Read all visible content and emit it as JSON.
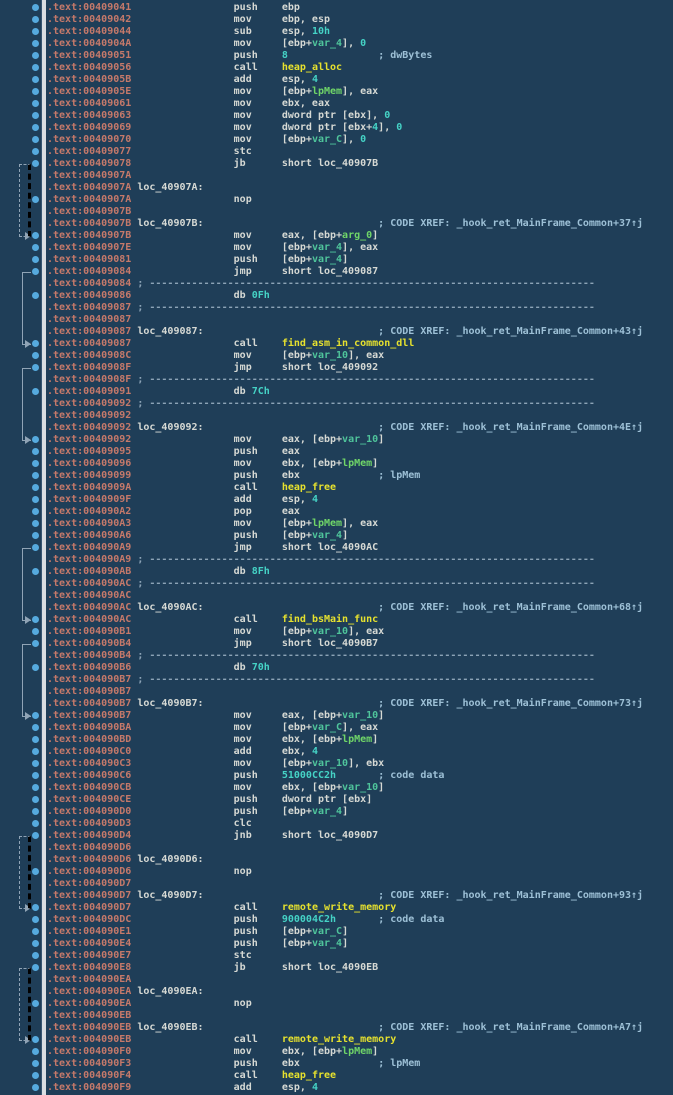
{
  "listing": {
    "colors": {
      "background": "#1f3e58",
      "address": "#c5796a",
      "default_text": "#d6d9d4",
      "number": "#45d3c6",
      "function_name": "#e6e12e",
      "stack_var": "#4fc49b",
      "named_var": "#70d668",
      "comment": "#9dc0d6",
      "separator": "#8ca3b6",
      "dot": "#56aade",
      "jump_line": "#90a4b6",
      "divider_bar": "#d9dee2"
    },
    "layout": {
      "line_height": 12,
      "top_pad": 2,
      "label_col": 15,
      "mn_col": 31,
      "op_col": 39,
      "cmt_col": 55,
      "sep_col": 15
    },
    "separator_text": "; --------------------------------------------------------------------------",
    "arcs": [
      {
        "f": 14,
        "t": 20,
        "s": "d"
      },
      {
        "f": 23,
        "t": 29,
        "s": "s"
      },
      {
        "f": 31,
        "t": 37,
        "s": "s"
      },
      {
        "f": 46,
        "t": 52,
        "s": "s"
      },
      {
        "f": 54,
        "t": 60,
        "s": "s"
      },
      {
        "f": 70,
        "t": 76,
        "s": "d"
      },
      {
        "f": 81,
        "t": 87,
        "s": "d"
      }
    ],
    "lines": [
      {
        "a": ".text:00409041",
        "d": 1,
        "m": "push",
        "o": [
          [
            "p",
            "ebp"
          ]
        ]
      },
      {
        "a": ".text:00409042",
        "d": 1,
        "m": "mov",
        "o": [
          [
            "p",
            "ebp, esp"
          ]
        ]
      },
      {
        "a": ".text:00409044",
        "d": 1,
        "m": "sub",
        "o": [
          [
            "p",
            "esp, "
          ],
          [
            "n",
            "10h"
          ]
        ]
      },
      {
        "a": ".text:0040904A",
        "d": 1,
        "m": "mov",
        "o": [
          [
            "p",
            "[ebp+"
          ],
          [
            "v",
            "var_4"
          ],
          [
            "p",
            "], "
          ],
          [
            "n",
            "0"
          ]
        ]
      },
      {
        "a": ".text:00409051",
        "d": 1,
        "m": "push",
        "o": [
          [
            "n",
            "8"
          ]
        ],
        "c": "; dwBytes"
      },
      {
        "a": ".text:00409056",
        "d": 1,
        "m": "call",
        "o": [
          [
            "f",
            "heap_alloc"
          ]
        ]
      },
      {
        "a": ".text:0040905B",
        "d": 1,
        "m": "add",
        "o": [
          [
            "p",
            "esp, "
          ],
          [
            "n",
            "4"
          ]
        ]
      },
      {
        "a": ".text:0040905E",
        "d": 1,
        "m": "mov",
        "o": [
          [
            "p",
            "[ebp+"
          ],
          [
            "g",
            "lpMem"
          ],
          [
            "p",
            "], eax"
          ]
        ]
      },
      {
        "a": ".text:00409061",
        "d": 1,
        "m": "mov",
        "o": [
          [
            "p",
            "ebx, eax"
          ]
        ]
      },
      {
        "a": ".text:00409063",
        "d": 1,
        "m": "mov",
        "o": [
          [
            "p",
            "dword ptr [ebx], "
          ],
          [
            "n",
            "0"
          ]
        ]
      },
      {
        "a": ".text:00409069",
        "d": 1,
        "m": "mov",
        "o": [
          [
            "p",
            "dword ptr [ebx+"
          ],
          [
            "n",
            "4"
          ],
          [
            "p",
            "], "
          ],
          [
            "n",
            "0"
          ]
        ]
      },
      {
        "a": ".text:00409070",
        "d": 1,
        "m": "mov",
        "o": [
          [
            "p",
            "[ebp+"
          ],
          [
            "v",
            "var_C"
          ],
          [
            "p",
            "], "
          ],
          [
            "n",
            "0"
          ]
        ]
      },
      {
        "a": ".text:00409077",
        "d": 1,
        "m": "stc"
      },
      {
        "a": ".text:00409078",
        "d": 1,
        "m": "jb",
        "o": [
          [
            "p",
            "short loc_40907B"
          ]
        ]
      },
      {
        "a": ".text:0040907A"
      },
      {
        "a": ".text:0040907A",
        "l": "loc_40907A:"
      },
      {
        "a": ".text:0040907A",
        "d": 1,
        "m": "nop"
      },
      {
        "a": ".text:0040907B"
      },
      {
        "a": ".text:0040907B",
        "l": "loc_40907B:",
        "c": "; CODE XREF: _hook_ret_MainFrame_Common+37↑j"
      },
      {
        "a": ".text:0040907B",
        "d": 1,
        "t": 1,
        "m": "mov",
        "o": [
          [
            "p",
            "eax, [ebp+"
          ],
          [
            "g",
            "arg_0"
          ],
          [
            "p",
            "]"
          ]
        ]
      },
      {
        "a": ".text:0040907E",
        "d": 1,
        "m": "mov",
        "o": [
          [
            "p",
            "[ebp+"
          ],
          [
            "v",
            "var_4"
          ],
          [
            "p",
            "], eax"
          ]
        ]
      },
      {
        "a": ".text:00409081",
        "d": 1,
        "m": "push",
        "o": [
          [
            "p",
            "[ebp+"
          ],
          [
            "v",
            "var_4"
          ],
          [
            "p",
            "]"
          ]
        ]
      },
      {
        "a": ".text:00409084",
        "d": 1,
        "m": "jmp",
        "o": [
          [
            "p",
            "short loc_409087"
          ]
        ]
      },
      {
        "a": ".text:00409084",
        "s": 1
      },
      {
        "a": ".text:00409086",
        "d": 1,
        "b": 1,
        "m": "db",
        "o": [
          [
            "n",
            "0Fh"
          ]
        ]
      },
      {
        "a": ".text:00409087",
        "s": 1
      },
      {
        "a": ".text:00409087"
      },
      {
        "a": ".text:00409087",
        "l": "loc_409087:",
        "c": "; CODE XREF: _hook_ret_MainFrame_Common+43↑j"
      },
      {
        "a": ".text:00409087",
        "d": 1,
        "t": 1,
        "m": "call",
        "o": [
          [
            "f",
            "find_asm_in_common_dll"
          ]
        ]
      },
      {
        "a": ".text:0040908C",
        "d": 1,
        "m": "mov",
        "o": [
          [
            "p",
            "[ebp+"
          ],
          [
            "v",
            "var_10"
          ],
          [
            "p",
            "], eax"
          ]
        ]
      },
      {
        "a": ".text:0040908F",
        "d": 1,
        "m": "jmp",
        "o": [
          [
            "p",
            "short loc_409092"
          ]
        ]
      },
      {
        "a": ".text:0040908F",
        "s": 1
      },
      {
        "a": ".text:00409091",
        "d": 1,
        "b": 1,
        "m": "db",
        "o": [
          [
            "n",
            "7Ch"
          ]
        ]
      },
      {
        "a": ".text:00409092",
        "s": 1
      },
      {
        "a": ".text:00409092"
      },
      {
        "a": ".text:00409092",
        "l": "loc_409092:",
        "c": "; CODE XREF: _hook_ret_MainFrame_Common+4E↑j"
      },
      {
        "a": ".text:00409092",
        "d": 1,
        "t": 1,
        "m": "mov",
        "o": [
          [
            "p",
            "eax, [ebp+"
          ],
          [
            "v",
            "var_10"
          ],
          [
            "p",
            "]"
          ]
        ]
      },
      {
        "a": ".text:00409095",
        "d": 1,
        "m": "push",
        "o": [
          [
            "p",
            "eax"
          ]
        ]
      },
      {
        "a": ".text:00409096",
        "d": 1,
        "m": "mov",
        "o": [
          [
            "p",
            "ebx, [ebp+"
          ],
          [
            "g",
            "lpMem"
          ],
          [
            "p",
            "]"
          ]
        ]
      },
      {
        "a": ".text:00409099",
        "d": 1,
        "m": "push",
        "o": [
          [
            "p",
            "ebx"
          ]
        ],
        "c": "; lpMem"
      },
      {
        "a": ".text:0040909A",
        "d": 1,
        "m": "call",
        "o": [
          [
            "f",
            "heap_free"
          ]
        ]
      },
      {
        "a": ".text:0040909F",
        "d": 1,
        "m": "add",
        "o": [
          [
            "p",
            "esp, "
          ],
          [
            "n",
            "4"
          ]
        ]
      },
      {
        "a": ".text:004090A2",
        "d": 1,
        "m": "pop",
        "o": [
          [
            "p",
            "eax"
          ]
        ]
      },
      {
        "a": ".text:004090A3",
        "d": 1,
        "m": "mov",
        "o": [
          [
            "p",
            "[ebp+"
          ],
          [
            "g",
            "lpMem"
          ],
          [
            "p",
            "], eax"
          ]
        ]
      },
      {
        "a": ".text:004090A6",
        "d": 1,
        "m": "push",
        "o": [
          [
            "p",
            "[ebp+"
          ],
          [
            "v",
            "var_4"
          ],
          [
            "p",
            "]"
          ]
        ]
      },
      {
        "a": ".text:004090A9",
        "d": 1,
        "m": "jmp",
        "o": [
          [
            "p",
            "short loc_4090AC"
          ]
        ]
      },
      {
        "a": ".text:004090A9",
        "s": 1
      },
      {
        "a": ".text:004090AB",
        "d": 1,
        "b": 1,
        "m": "db",
        "o": [
          [
            "n",
            "8Fh"
          ]
        ]
      },
      {
        "a": ".text:004090AC",
        "s": 1
      },
      {
        "a": ".text:004090AC"
      },
      {
        "a": ".text:004090AC",
        "l": "loc_4090AC:",
        "c": "; CODE XREF: _hook_ret_MainFrame_Common+68↑j"
      },
      {
        "a": ".text:004090AC",
        "d": 1,
        "t": 1,
        "m": "call",
        "o": [
          [
            "f",
            "find_bsMain_func"
          ]
        ]
      },
      {
        "a": ".text:004090B1",
        "d": 1,
        "m": "mov",
        "o": [
          [
            "p",
            "[ebp+"
          ],
          [
            "v",
            "var_10"
          ],
          [
            "p",
            "], eax"
          ]
        ]
      },
      {
        "a": ".text:004090B4",
        "d": 1,
        "m": "jmp",
        "o": [
          [
            "p",
            "short loc_4090B7"
          ]
        ]
      },
      {
        "a": ".text:004090B4",
        "s": 1
      },
      {
        "a": ".text:004090B6",
        "d": 1,
        "b": 1,
        "m": "db",
        "o": [
          [
            "n",
            "70h"
          ]
        ]
      },
      {
        "a": ".text:004090B7",
        "s": 1
      },
      {
        "a": ".text:004090B7"
      },
      {
        "a": ".text:004090B7",
        "l": "loc_4090B7:",
        "c": "; CODE XREF: _hook_ret_MainFrame_Common+73↑j"
      },
      {
        "a": ".text:004090B7",
        "d": 1,
        "t": 1,
        "m": "mov",
        "o": [
          [
            "p",
            "eax, [ebp+"
          ],
          [
            "v",
            "var_10"
          ],
          [
            "p",
            "]"
          ]
        ]
      },
      {
        "a": ".text:004090BA",
        "d": 1,
        "m": "mov",
        "o": [
          [
            "p",
            "[ebp+"
          ],
          [
            "v",
            "var_C"
          ],
          [
            "p",
            "], eax"
          ]
        ]
      },
      {
        "a": ".text:004090BD",
        "d": 1,
        "m": "mov",
        "o": [
          [
            "p",
            "ebx, [ebp+"
          ],
          [
            "g",
            "lpMem"
          ],
          [
            "p",
            "]"
          ]
        ]
      },
      {
        "a": ".text:004090C0",
        "d": 1,
        "m": "add",
        "o": [
          [
            "p",
            "ebx, "
          ],
          [
            "n",
            "4"
          ]
        ]
      },
      {
        "a": ".text:004090C3",
        "d": 1,
        "m": "mov",
        "o": [
          [
            "p",
            "[ebp+"
          ],
          [
            "v",
            "var_10"
          ],
          [
            "p",
            "], ebx"
          ]
        ]
      },
      {
        "a": ".text:004090C6",
        "d": 1,
        "m": "push",
        "o": [
          [
            "n",
            "51000CC2h"
          ]
        ],
        "c": "; code data"
      },
      {
        "a": ".text:004090CB",
        "d": 1,
        "m": "mov",
        "o": [
          [
            "p",
            "ebx, [ebp+"
          ],
          [
            "v",
            "var_10"
          ],
          [
            "p",
            "]"
          ]
        ]
      },
      {
        "a": ".text:004090CE",
        "d": 1,
        "m": "push",
        "o": [
          [
            "p",
            "dword ptr [ebx]"
          ]
        ]
      },
      {
        "a": ".text:004090D0",
        "d": 1,
        "m": "push",
        "o": [
          [
            "p",
            "[ebp+"
          ],
          [
            "v",
            "var_4"
          ],
          [
            "p",
            "]"
          ]
        ]
      },
      {
        "a": ".text:004090D3",
        "d": 1,
        "m": "clc"
      },
      {
        "a": ".text:004090D4",
        "d": 1,
        "m": "jnb",
        "o": [
          [
            "p",
            "short loc_4090D7"
          ]
        ]
      },
      {
        "a": ".text:004090D6"
      },
      {
        "a": ".text:004090D6",
        "l": "loc_4090D6:"
      },
      {
        "a": ".text:004090D6",
        "d": 1,
        "m": "nop"
      },
      {
        "a": ".text:004090D7"
      },
      {
        "a": ".text:004090D7",
        "l": "loc_4090D7:",
        "c": "; CODE XREF: _hook_ret_MainFrame_Common+93↑j"
      },
      {
        "a": ".text:004090D7",
        "d": 1,
        "t": 1,
        "m": "call",
        "o": [
          [
            "f",
            "remote_write_memory"
          ]
        ]
      },
      {
        "a": ".text:004090DC",
        "d": 1,
        "m": "push",
        "o": [
          [
            "n",
            "900004C2h"
          ]
        ],
        "c": "; code data"
      },
      {
        "a": ".text:004090E1",
        "d": 1,
        "m": "push",
        "o": [
          [
            "p",
            "[ebp+"
          ],
          [
            "v",
            "var_C"
          ],
          [
            "p",
            "]"
          ]
        ]
      },
      {
        "a": ".text:004090E4",
        "d": 1,
        "m": "push",
        "o": [
          [
            "p",
            "[ebp+"
          ],
          [
            "v",
            "var_4"
          ],
          [
            "p",
            "]"
          ]
        ]
      },
      {
        "a": ".text:004090E7",
        "d": 1,
        "m": "stc"
      },
      {
        "a": ".text:004090E8",
        "d": 1,
        "m": "jb",
        "o": [
          [
            "p",
            "short loc_4090EB"
          ]
        ]
      },
      {
        "a": ".text:004090EA"
      },
      {
        "a": ".text:004090EA",
        "l": "loc_4090EA:"
      },
      {
        "a": ".text:004090EA",
        "d": 1,
        "m": "nop"
      },
      {
        "a": ".text:004090EB"
      },
      {
        "a": ".text:004090EB",
        "l": "loc_4090EB:",
        "c": "; CODE XREF: _hook_ret_MainFrame_Common+A7↑j"
      },
      {
        "a": ".text:004090EB",
        "d": 1,
        "t": 1,
        "m": "call",
        "o": [
          [
            "f",
            "remote_write_memory"
          ]
        ]
      },
      {
        "a": ".text:004090F0",
        "d": 1,
        "m": "mov",
        "o": [
          [
            "p",
            "ebx, [ebp+"
          ],
          [
            "g",
            "lpMem"
          ],
          [
            "p",
            "]"
          ]
        ]
      },
      {
        "a": ".text:004090F3",
        "d": 1,
        "m": "push",
        "o": [
          [
            "p",
            "ebx"
          ]
        ],
        "c": "; lpMem"
      },
      {
        "a": ".text:004090F4",
        "d": 1,
        "m": "call",
        "o": [
          [
            "f",
            "heap_free"
          ]
        ]
      },
      {
        "a": ".text:004090F9",
        "d": 1,
        "m": "add",
        "o": [
          [
            "p",
            "esp, "
          ],
          [
            "n",
            "4"
          ]
        ]
      }
    ]
  }
}
